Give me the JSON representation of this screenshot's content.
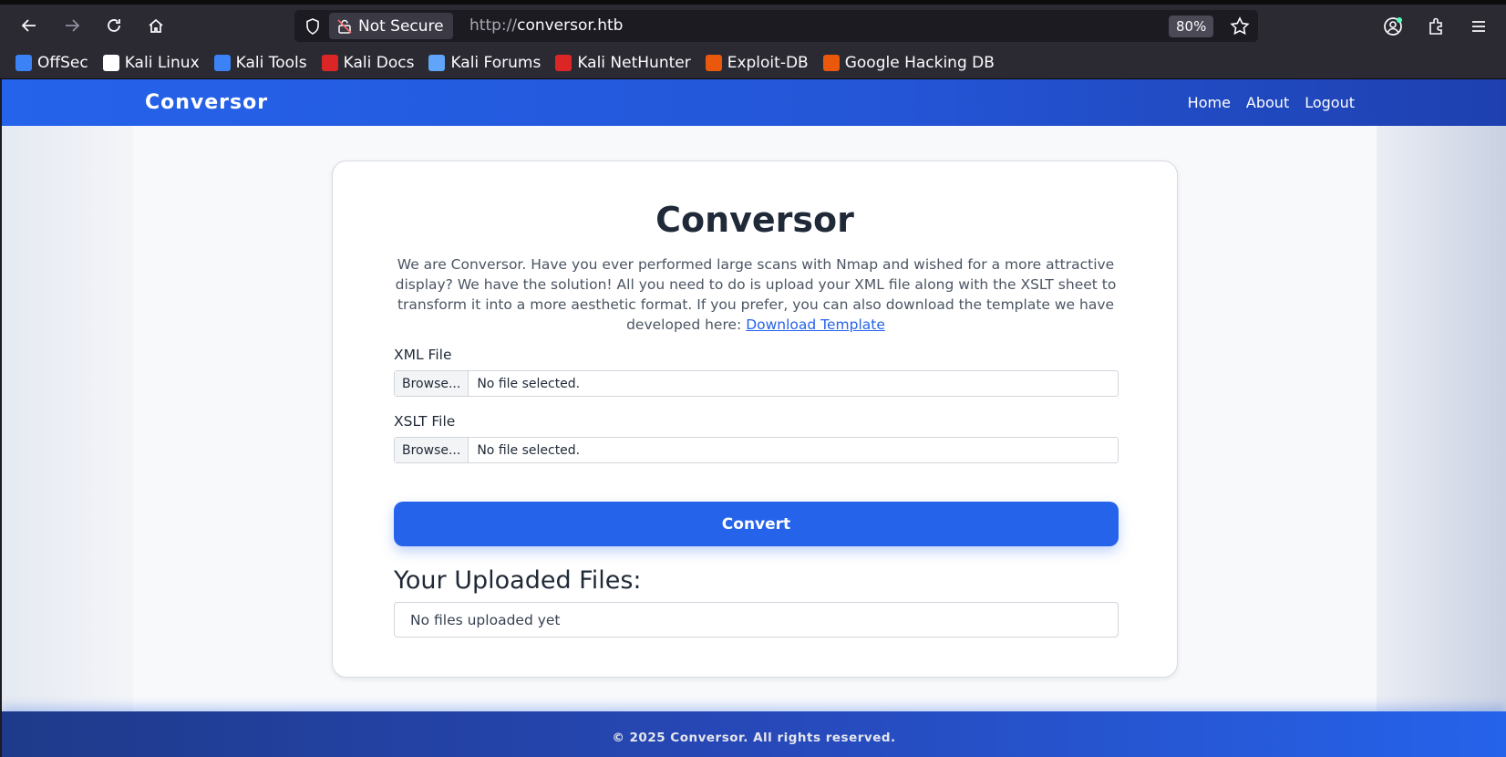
{
  "browser": {
    "security_label": "Not Secure",
    "url_protocol": "http://",
    "url_host": "conversor.htb",
    "zoom": "80%",
    "bookmarks": [
      {
        "label": "OffSec",
        "icon": "offsec-icon",
        "color": "#3b82f6"
      },
      {
        "label": "Kali Linux",
        "icon": "kali-dragon-icon",
        "color": "#ffffff"
      },
      {
        "label": "Kali Tools",
        "icon": "kali-tools-icon",
        "color": "#3b82f6"
      },
      {
        "label": "Kali Docs",
        "icon": "kali-docs-icon",
        "color": "#dc2626"
      },
      {
        "label": "Kali Forums",
        "icon": "kali-forums-icon",
        "color": "#60a5fa"
      },
      {
        "label": "Kali NetHunter",
        "icon": "kali-nethunter-icon",
        "color": "#dc2626"
      },
      {
        "label": "Exploit-DB",
        "icon": "exploit-db-icon",
        "color": "#ea580c"
      },
      {
        "label": "Google Hacking DB",
        "icon": "ghdb-icon",
        "color": "#ea580c"
      }
    ]
  },
  "site": {
    "brand": "Conversor",
    "nav": [
      "Home",
      "About",
      "Logout"
    ]
  },
  "main": {
    "title": "Conversor",
    "intro": "We are Conversor. Have you ever performed large scans with Nmap and wished for a more attractive display? We have the solution! All you need to do is upload your XML file along with the XSLT sheet to transform it into a more aesthetic format. If you prefer, you can also download the template we have developed here: ",
    "download_link": "Download Template",
    "xml_label": "XML File",
    "xslt_label": "XSLT File",
    "browse_label": "Browse...",
    "no_file": "No file selected.",
    "convert_label": "Convert",
    "uploaded_title": "Your Uploaded Files:",
    "uploaded_empty": "No files uploaded yet"
  },
  "footer": {
    "text": "© 2025 Conversor. All rights reserved."
  },
  "colors": {
    "accent": "#2563eb",
    "header_end": "#1e40af"
  }
}
